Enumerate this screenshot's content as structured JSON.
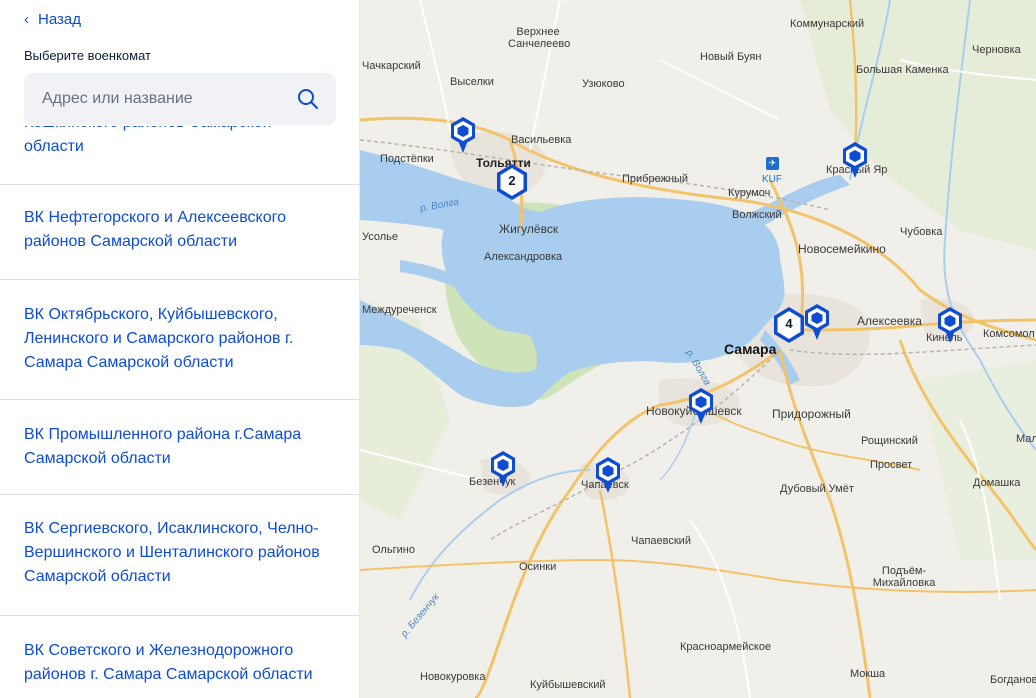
{
  "nav": {
    "back_label": "Назад"
  },
  "panel": {
    "title": "Выберите военкомат"
  },
  "search": {
    "placeholder": "Адрес или название"
  },
  "offices": [
    {
      "label": "Кошкинского районов Самарской области"
    },
    {
      "label": "ВК Нефтегорского и Алексеевского районов Самарской области"
    },
    {
      "label": "ВК Октябрьского, Куйбышевского, Ленинского и Самарского районов г. Самара Самарской области"
    },
    {
      "label": "ВК Промышленного района г.Самара Самарской области"
    },
    {
      "label": "ВК Сергиевского, Исаклинского, Челно-Вершинского и Шенталинского районов Самарской области"
    },
    {
      "label": "ВК Советского и Железнодорожного районов г. Самара Самарской области"
    }
  ],
  "map": {
    "places": {
      "verkhnee_sancheleevo": "Верхнее\nСанчелеево",
      "kommunarsky": "Коммунарский",
      "chernovka": "Черновка",
      "chachkarsky": "Чачкарский",
      "vyselki": "Выселки",
      "uzyukovo": "Узюково",
      "novy_buyan": "Новый Буян",
      "bolshaya_kamenka": "Большая Каменка",
      "podstepki": "Подстёпки",
      "vasilyevka": "Васильевка",
      "tolyatti": "Тольятти",
      "pribrezhny": "Прибрежный",
      "kurumoch": "Курумоч",
      "krasny_yar": "Красный Яр",
      "kuf": "KUF",
      "volzhsky": "Волжский",
      "zhigulevsk": "Жигулёвск",
      "usolye": "Усолье",
      "chubovka": "Чубовка",
      "novosemeykino": "Новосемейкино",
      "aleksandrovka": "Александровка",
      "mezhdurechensk": "Междуреченск",
      "alekseevka": "Алексеевка",
      "kinel": "Кинель",
      "komsomolsky": "Комсомол",
      "samara": "Самара",
      "novokuybyshevsk": "Новокуйбышевск",
      "pridorozhny": "Придорожный",
      "roshchinsky": "Рощинский",
      "prosvet": "Просвет",
      "bezenchuk": "Безенчук",
      "chapaevsk": "Чапаевск",
      "dubovy_umet": "Дубовый Умёт",
      "domashka": "Домашка",
      "olgino": "Ольгино",
      "chapaevsky": "Чапаевский",
      "osinki": "Осинки",
      "podyom_mikhaylovka": "Подъём-\nМихайловка",
      "krasnoarmeyskoe": "Красноармейское",
      "novokurovka": "Новокуровка",
      "moksha": "Мокша",
      "kuybyshevsky": "Куйбышевский",
      "bogdanovka": "Богдановка",
      "malo": "Мал",
      "river_volga": "р. Волга",
      "river_volga2": "р. Волга",
      "river_bezenchuk": "р. Безенчук"
    },
    "clusters": [
      {
        "count": "2"
      },
      {
        "count": "4"
      }
    ],
    "colors": {
      "marker": "#0d4cd3",
      "water": "#a9cdee",
      "forest": "#cfe3b8",
      "road_major": "#f3c36a",
      "road_minor": "#ffffff",
      "urban": "#e8e4dc"
    }
  }
}
